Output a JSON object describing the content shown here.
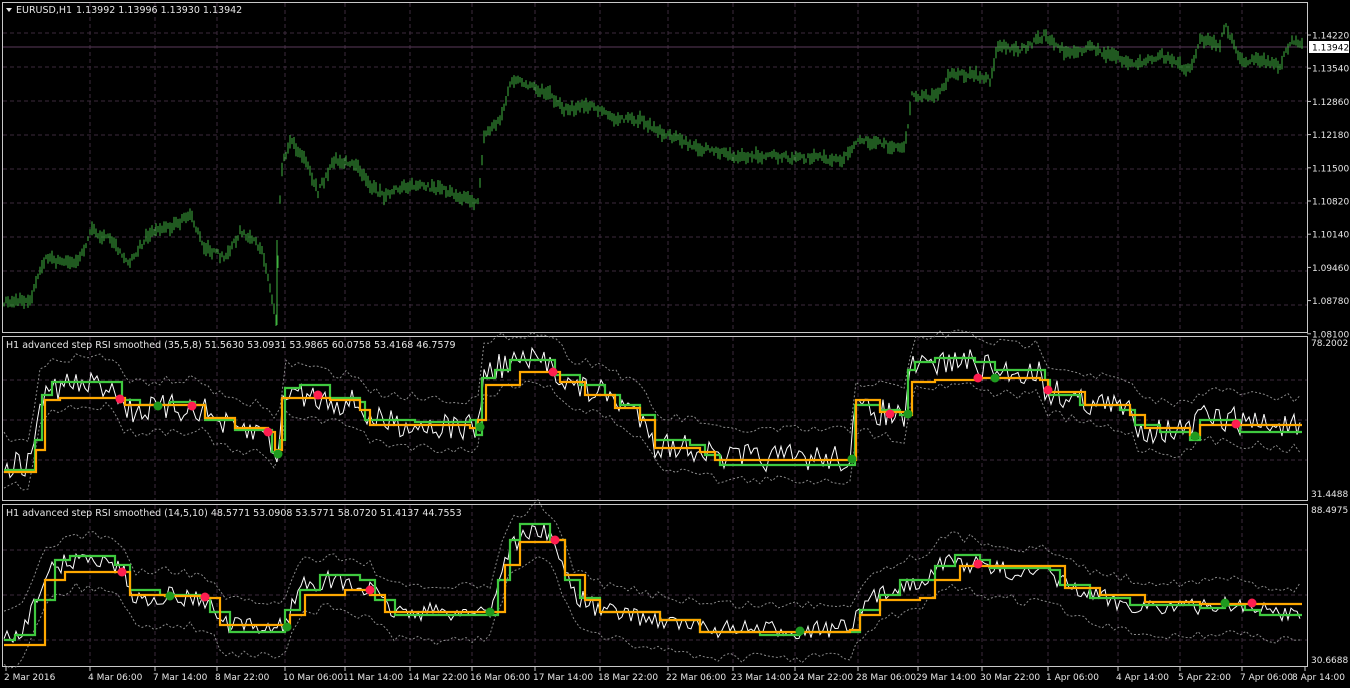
{
  "colors": {
    "background": "#000000",
    "frame": "#c8c8c8",
    "grid": "#3c2a3c",
    "price_bars": "#3fb23f",
    "fast_line": "#3fc93f",
    "slow_line": "#ffa800",
    "raw_rsi": "#ffffff",
    "bands": "#8a8a8a",
    "sell_dot": "#ff1e50",
    "buy_dot": "#1f9a1f",
    "price_line": "#5a3a5a"
  },
  "main_panel": {
    "title": "EURUSD,H1",
    "ohlc": "1.13992 1.13996 1.13930 1.13942",
    "current_price": "1.13942",
    "price_ticks": [
      "1.14220",
      "1.13540",
      "1.12860",
      "1.12180",
      "1.11500",
      "1.10820",
      "1.10140",
      "1.09460",
      "1.08780",
      "1.08100"
    ],
    "menu_icon": "triangle-down-icon"
  },
  "indicator_1": {
    "title": "H1 advanced step RSI smoothed (35,5,8) 51.5630 53.0931 53.9865 60.0758 53.4168 46.7579",
    "top": "78.2002",
    "bottom": "31.4488"
  },
  "indicator_2": {
    "title": "H1 advanced step RSI smoothed (14,5,10) 48.5771 53.0908 53.5771 58.0720 51.4137 44.7553",
    "top": "88.4975",
    "bottom": "30.6688"
  },
  "time_axis": [
    "2 Mar 2016",
    "4 Mar 06:00",
    "7 Mar 14:00",
    "8 Mar 22:00",
    "10 Mar 06:00",
    "11 Mar 14:00",
    "14 Mar 22:00",
    "16 Mar 06:00",
    "17 Mar 14:00",
    "18 Mar 22:00",
    "22 Mar 06:00",
    "23 Mar 14:00",
    "24 Mar 22:00",
    "28 Mar 06:00",
    "29 Mar 14:00",
    "30 Mar 22:00",
    "1 Apr 06:00",
    "4 Apr 14:00",
    "5 Apr 22:00",
    "7 Apr 06:00",
    "8 Apr 14:00"
  ]
}
